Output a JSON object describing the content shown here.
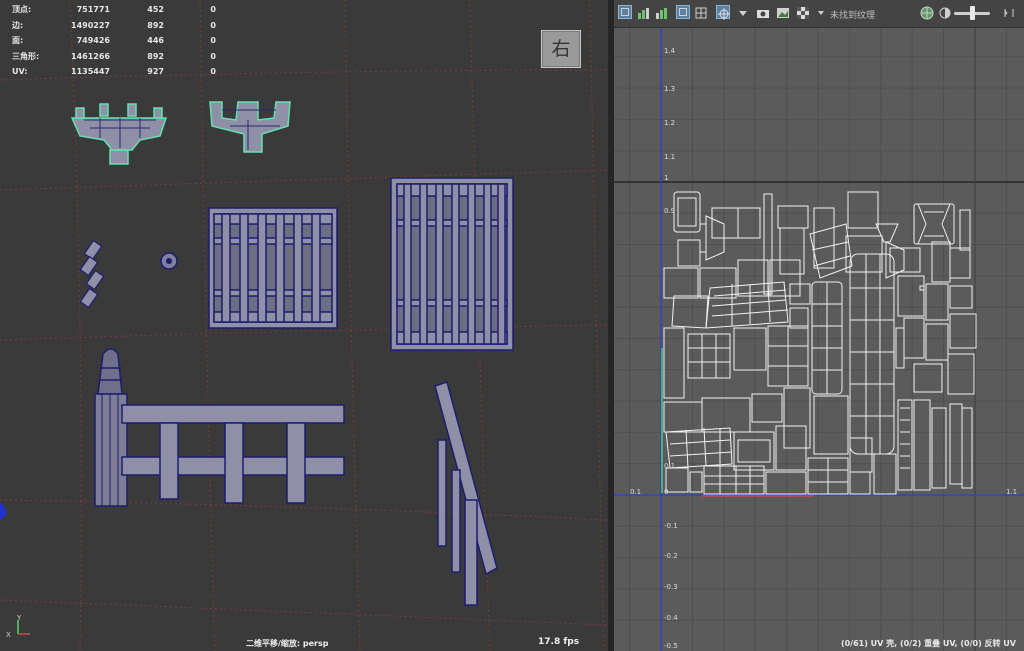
{
  "viewport": {
    "stats": [
      {
        "label": "顶点:",
        "v1": "751771",
        "v2": "452",
        "v3": "0"
      },
      {
        "label": "边:",
        "v1": "1490227",
        "v2": "892",
        "v3": "0"
      },
      {
        "label": "面:",
        "v1": "749426",
        "v2": "446",
        "v3": "0"
      },
      {
        "label": "三角形:",
        "v1": "1461266",
        "v2": "892",
        "v3": "0"
      },
      {
        "label": "UV:",
        "v1": "1135447",
        "v2": "927",
        "v3": "0"
      }
    ],
    "view_cube_label": "右",
    "camera_label": "二维平移/缩放: persp",
    "fps": "17.8 fps",
    "axis_labels": {
      "x": "X",
      "y": "Y"
    }
  },
  "uv_editor": {
    "toolbar_texture_label": "未找到纹理",
    "status_text": "(0/61) UV 壳, (0/2) 重叠 UV, (0/0) 反转 UV",
    "axis_x_labels": [
      "0.1",
      "1.1"
    ],
    "axis_y_labels": [
      "1.4",
      "1.3",
      "1.2",
      "1.1",
      "1",
      "0.9",
      "0.1",
      "0",
      "-0.1",
      "-0.2",
      "-0.3",
      "-0.4",
      "-0.5"
    ],
    "icons": [
      "uv-grid-icon",
      "bar-chart-icon",
      "bar-chart-alt-icon",
      "frame-icon",
      "grid-icon",
      "crosshair-icon",
      "camera-icon",
      "image-icon",
      "checker-icon",
      "dropdown-arrow-icon",
      "globe-icon",
      "expand-icon"
    ]
  },
  "colors": {
    "viewport_bg": "#3a3a3a",
    "mesh_fill": "#8f8fa7",
    "mesh_edge": "#1d1d6e",
    "selection_green": "#66e0b0",
    "uv_grid_bg": "#5b5b5b",
    "uv_axis_blue": "#2e3fd0"
  }
}
